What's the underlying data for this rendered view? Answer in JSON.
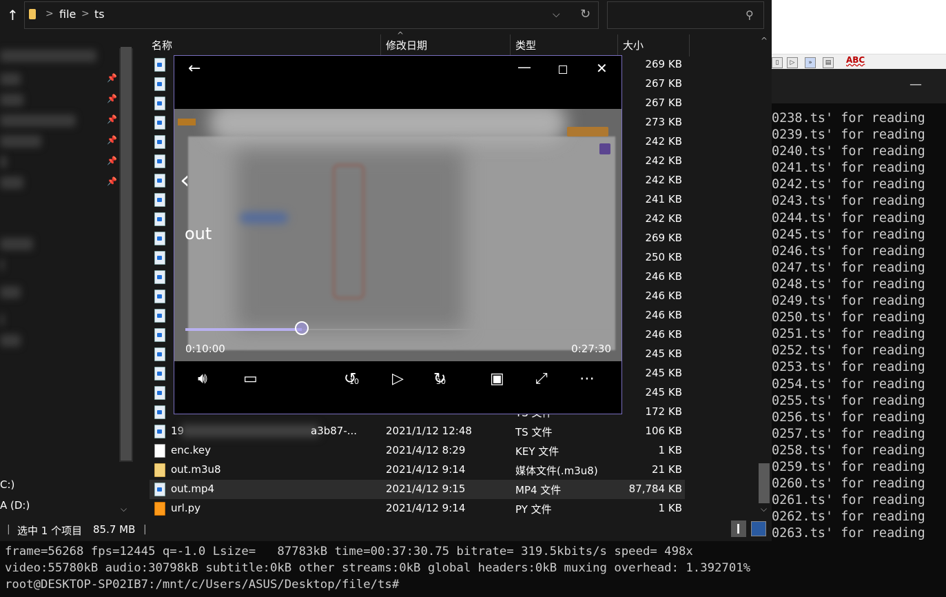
{
  "terminal": {
    "right_lines": [
      "0238.ts' for reading",
      "0239.ts' for reading",
      "0240.ts' for reading",
      "0241.ts' for reading",
      "0242.ts' for reading",
      "0243.ts' for reading",
      "0244.ts' for reading",
      "0245.ts' for reading",
      "0246.ts' for reading",
      "0247.ts' for reading",
      "0248.ts' for reading",
      "0249.ts' for reading",
      "0250.ts' for reading",
      "0251.ts' for reading",
      "0252.ts' for reading",
      "0253.ts' for reading",
      "0254.ts' for reading",
      "0255.ts' for reading",
      "0256.ts' for reading",
      "0257.ts' for reading",
      "0258.ts' for reading",
      "0259.ts' for reading",
      "0260.ts' for reading",
      "0261.ts' for reading",
      "0262.ts' for reading",
      "0263.ts' for reading"
    ],
    "bottom_lines": [
      "frame=56268 fps=12445 q=-1.0 Lsize=   87783kB time=00:37:30.75 bitrate= 319.5kbits/s speed= 498x",
      "video:55780kB audio:30798kB subtitle:0kB other streams:0kB global headers:0kB muxing overhead: 1.392701%",
      "root@DESKTOP-SP02IB7:/mnt/c/Users/ASUS/Desktop/file/ts#"
    ],
    "minimize_glyph": "—"
  },
  "word": {
    "spell_label": "ABC"
  },
  "explorer": {
    "up_glyph": "↑",
    "breadcrumb": [
      "file",
      "ts"
    ],
    "crumb_sep": ">",
    "search": {
      "placeholder": "",
      "value": ""
    },
    "nav": {
      "drive_c": "C:)",
      "drive_d": "A (D:)"
    },
    "columns": {
      "name": "名称",
      "modified": "修改日期",
      "type": "类型",
      "size": "大小"
    },
    "rows": [
      {
        "name": "",
        "date": "",
        "type": "",
        "size": "269 KB",
        "icon": "ts"
      },
      {
        "name": "",
        "date": "",
        "type": "",
        "size": "267 KB",
        "icon": "ts"
      },
      {
        "name": "",
        "date": "",
        "type": "",
        "size": "267 KB",
        "icon": "ts"
      },
      {
        "name": "",
        "date": "",
        "type": "",
        "size": "273 KB",
        "icon": "ts"
      },
      {
        "name": "",
        "date": "",
        "type": "",
        "size": "242 KB",
        "icon": "ts"
      },
      {
        "name": "",
        "date": "",
        "type": "",
        "size": "242 KB",
        "icon": "ts"
      },
      {
        "name": "",
        "date": "",
        "type": "",
        "size": "242 KB",
        "icon": "ts"
      },
      {
        "name": "",
        "date": "",
        "type": "",
        "size": "241 KB",
        "icon": "ts"
      },
      {
        "name": "",
        "date": "",
        "type": "",
        "size": "242 KB",
        "icon": "ts"
      },
      {
        "name": "",
        "date": "",
        "type": "",
        "size": "269 KB",
        "icon": "ts"
      },
      {
        "name": "",
        "date": "",
        "type": "",
        "size": "250 KB",
        "icon": "ts"
      },
      {
        "name": "",
        "date": "",
        "type": "",
        "size": "246 KB",
        "icon": "ts"
      },
      {
        "name": "",
        "date": "",
        "type": "",
        "size": "246 KB",
        "icon": "ts"
      },
      {
        "name": "",
        "date": "",
        "type": "",
        "size": "246 KB",
        "icon": "ts"
      },
      {
        "name": "",
        "date": "",
        "type": "",
        "size": "246 KB",
        "icon": "ts"
      },
      {
        "name": "",
        "date": "",
        "type": "",
        "size": "245 KB",
        "icon": "ts"
      },
      {
        "name": "",
        "date": "",
        "type": "",
        "size": "245 KB",
        "icon": "ts"
      },
      {
        "name": "",
        "date": "",
        "type": "",
        "size": "245 KB",
        "icon": "ts"
      },
      {
        "name": "",
        "date": "",
        "type": "TS 文件",
        "size": "172 KB",
        "icon": "ts"
      },
      {
        "name": "19",
        "name_tail": "a3b87-...",
        "date": "2021/1/12 12:48",
        "type": "TS 文件",
        "size": "106 KB",
        "icon": "ts"
      },
      {
        "name": "enc.key",
        "date": "2021/4/12 8:29",
        "type": "KEY 文件",
        "size": "1 KB",
        "icon": "key"
      },
      {
        "name": "out.m3u8",
        "date": "2021/4/12 9:14",
        "type": "媒体文件(.m3u8)",
        "size": "21 KB",
        "icon": "m3u8"
      },
      {
        "name": "out.mp4",
        "date": "2021/4/12 9:15",
        "type": "MP4 文件",
        "size": "87,784 KB",
        "icon": "mp4",
        "selected": true
      },
      {
        "name": "url.py",
        "date": "2021/4/12 9:14",
        "type": "PY 文件",
        "size": "1 KB",
        "icon": "py"
      }
    ],
    "status": {
      "selected": "选中 1 个项目",
      "size": "85.7 MB"
    }
  },
  "player": {
    "title": "out",
    "time_current": "0:10:00",
    "time_total": "0:27:30",
    "progress_fraction": 0.2727,
    "skip_back": "10",
    "skip_forward": "30"
  },
  "colors": {
    "accent": "#7a6fc0",
    "seek_fill": "#b8b0f0",
    "terminal_bg": "#0c0c0c",
    "explorer_bg": "#191919"
  }
}
